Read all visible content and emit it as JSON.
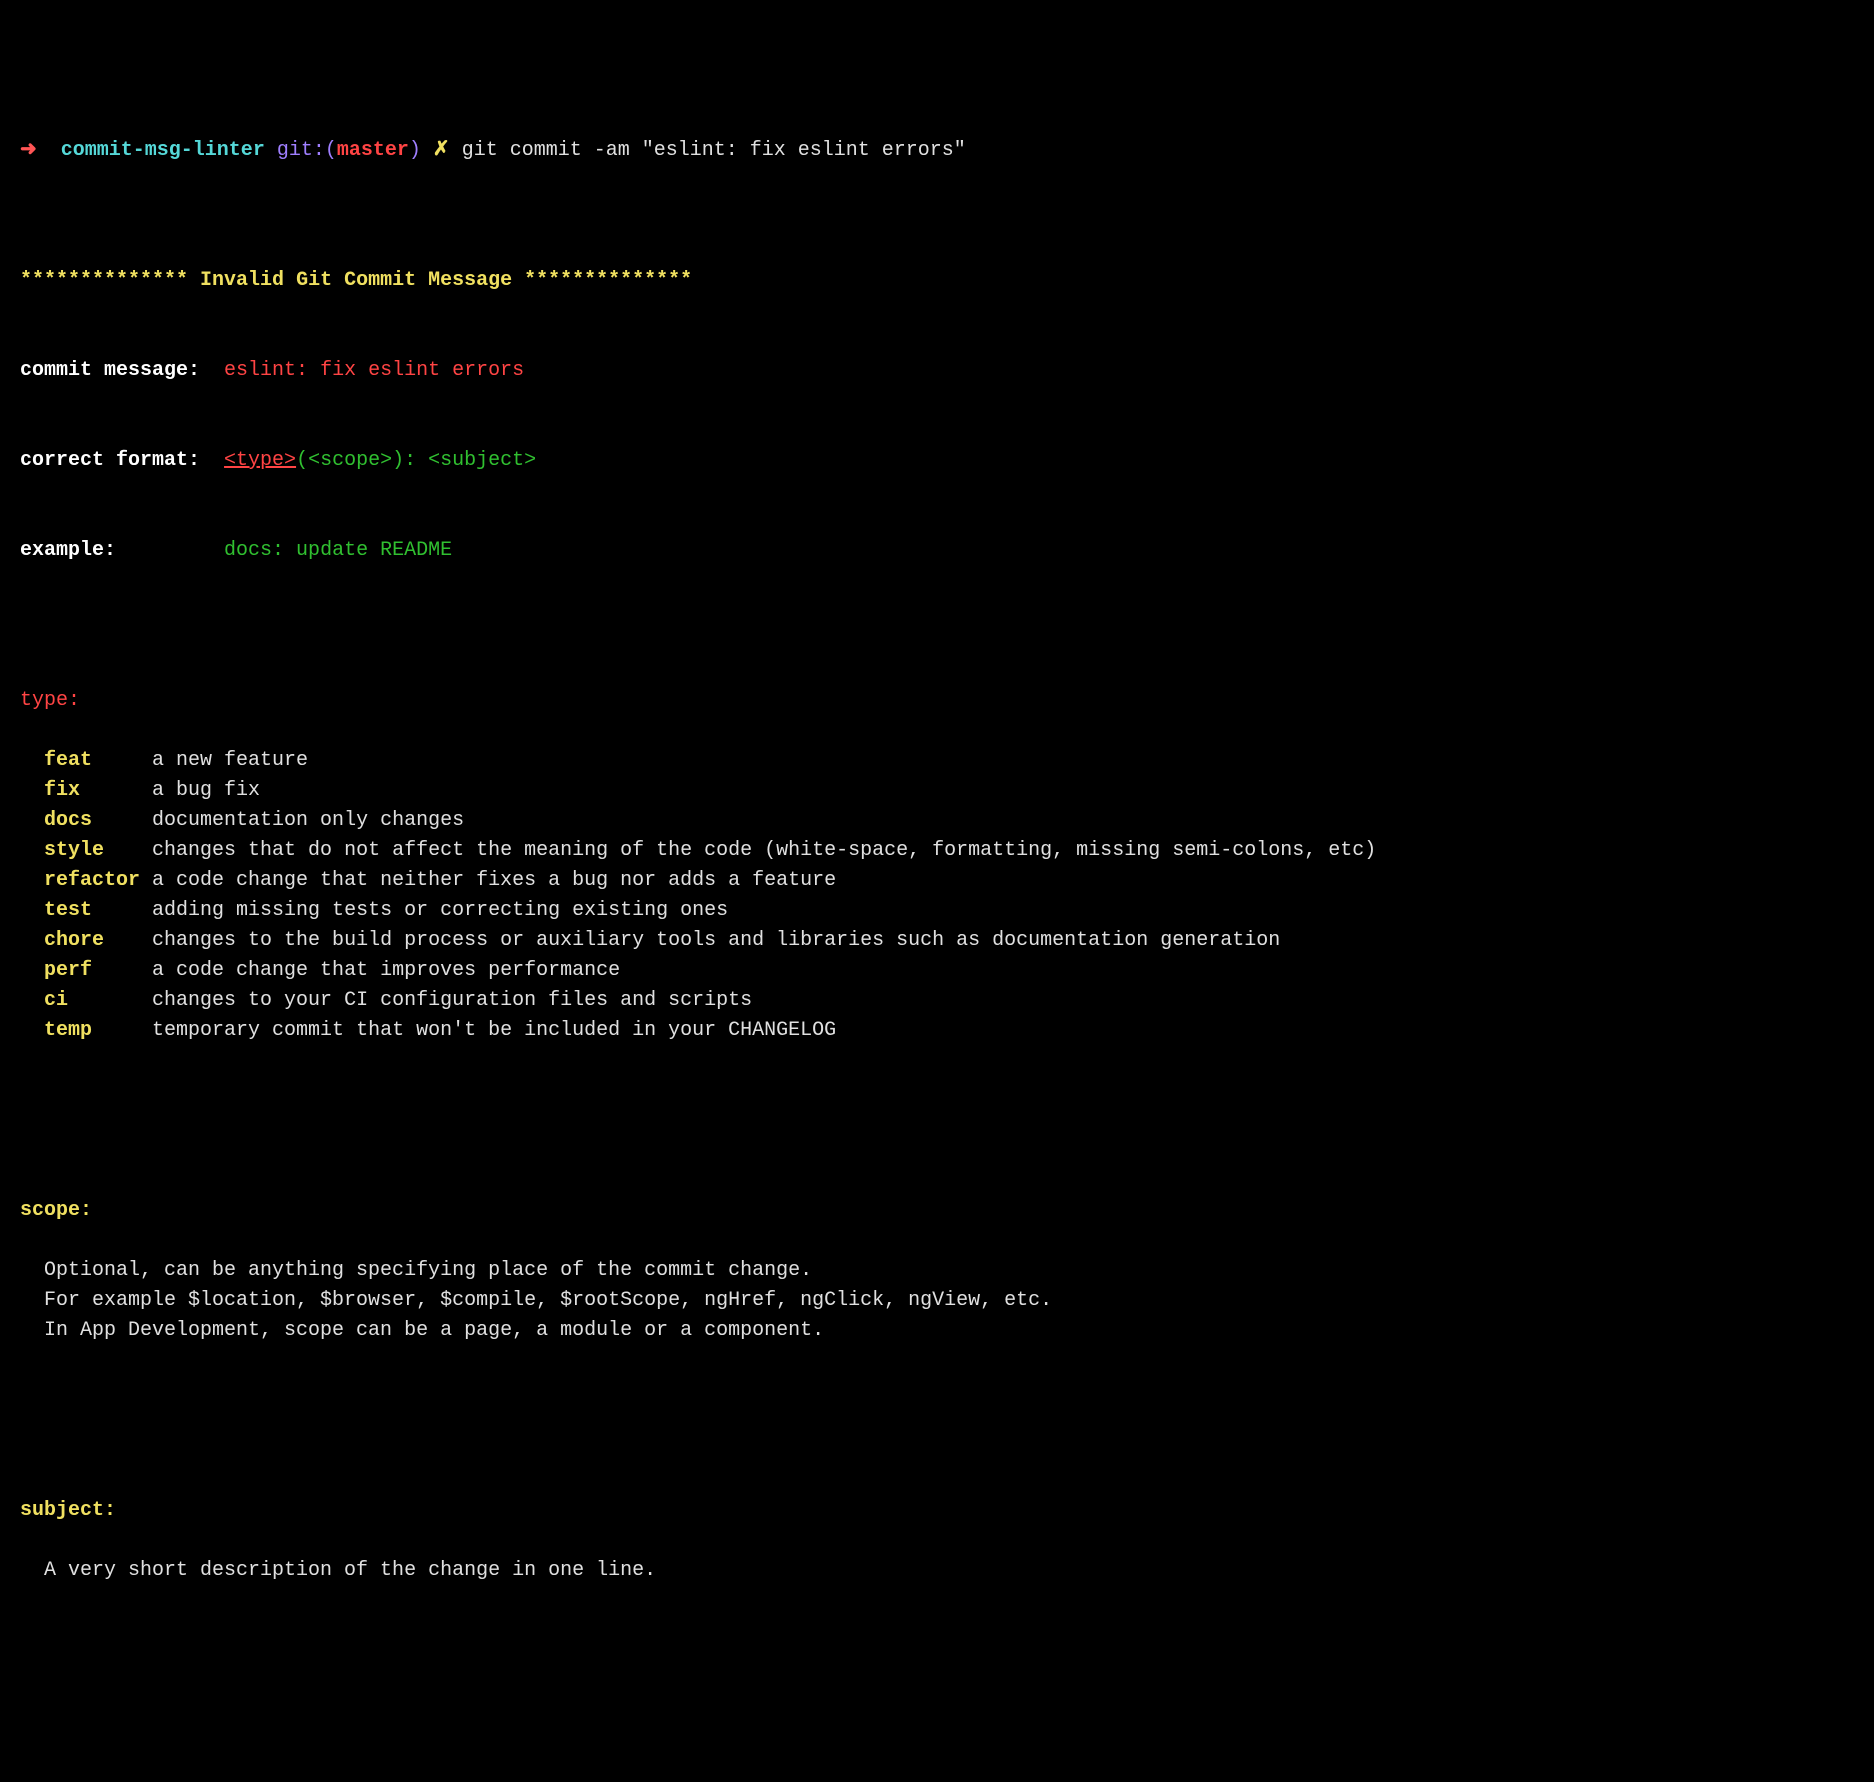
{
  "prompt": {
    "arrow": "➜",
    "dir": "commit-msg-linter",
    "git_prefix": "git:(",
    "branch": "master",
    "git_suffix": ")",
    "dirty": "✗",
    "command": "git commit -am \"eslint: fix eslint errors\""
  },
  "banner": {
    "stars_left": "**************",
    "title": "Invalid Git Commit Message",
    "stars_right": "**************"
  },
  "info": {
    "commit_label": "commit message:",
    "commit_value": "eslint: fix eslint errors",
    "format_label": "correct format:",
    "format_type": "<type>",
    "format_rest": "(<scope>): <subject>",
    "example_label": "example:",
    "example_value": "docs: update README"
  },
  "type_section": {
    "header": "type:",
    "types": [
      {
        "name": "feat",
        "desc": "a new feature"
      },
      {
        "name": "fix",
        "desc": "a bug fix"
      },
      {
        "name": "docs",
        "desc": "documentation only changes"
      },
      {
        "name": "style",
        "desc": "changes that do not affect the meaning of the code (white-space, formatting, missing semi-colons, etc)"
      },
      {
        "name": "refactor",
        "desc": "a code change that neither fixes a bug nor adds a feature"
      },
      {
        "name": "test",
        "desc": "adding missing tests or correcting existing ones"
      },
      {
        "name": "chore",
        "desc": "changes to the build process or auxiliary tools and libraries such as documentation generation"
      },
      {
        "name": "perf",
        "desc": "a code change that improves performance"
      },
      {
        "name": "ci",
        "desc": "changes to your CI configuration files and scripts"
      },
      {
        "name": "temp",
        "desc": "temporary commit that won't be included in your CHANGELOG"
      }
    ]
  },
  "scope_section": {
    "header": "scope:",
    "lines": [
      "Optional, can be anything specifying place of the commit change.",
      "For example $location, $browser, $compile, $rootScope, ngHref, ngClick, ngView, etc.",
      "In App Development, scope can be a page, a module or a component."
    ]
  },
  "subject_section": {
    "header": "subject:",
    "lines": [
      "A very short description of the change in one line."
    ]
  }
}
